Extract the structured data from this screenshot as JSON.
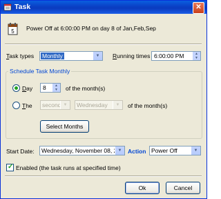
{
  "window": {
    "title": "Task",
    "close_glyph": "✕"
  },
  "header": {
    "icon": "calendar-task-icon",
    "summary": "Power Off at 6:00:00 PM on day 8 of Jan,Feb,Sep"
  },
  "task_types": {
    "label_u": "T",
    "label_rest": "ask types",
    "value": "Monthly"
  },
  "running_times": {
    "label_u": "R",
    "label_rest": "unning times",
    "value": "6:00:00 PM"
  },
  "schedule": {
    "group_title": "Schedule Task Monthly",
    "day_option": {
      "label_u": "D",
      "label_rest": "ay",
      "selected": true,
      "value": "8",
      "suffix": "of the month(s)"
    },
    "the_option": {
      "label_u": "T",
      "label_rest": "he",
      "selected": false,
      "ordinal": "second",
      "weekday": "Wednesday",
      "suffix": "of the month(s)"
    },
    "select_months_button": "Select Months"
  },
  "start_date": {
    "label": "Start Date:",
    "value": "Wednesday, November 08, 2"
  },
  "action": {
    "label": "Action",
    "value": "Power Off"
  },
  "enabled": {
    "checked": true,
    "label": "Enabled (the task runs at specified time)"
  },
  "buttons": {
    "ok": "Ok",
    "cancel": "Cancel"
  },
  "colors": {
    "title_bar": "#0a47d0",
    "dialog_bg": "#ece9d8",
    "accent_blue": "#0046d5",
    "radio_green": "#21a121"
  }
}
